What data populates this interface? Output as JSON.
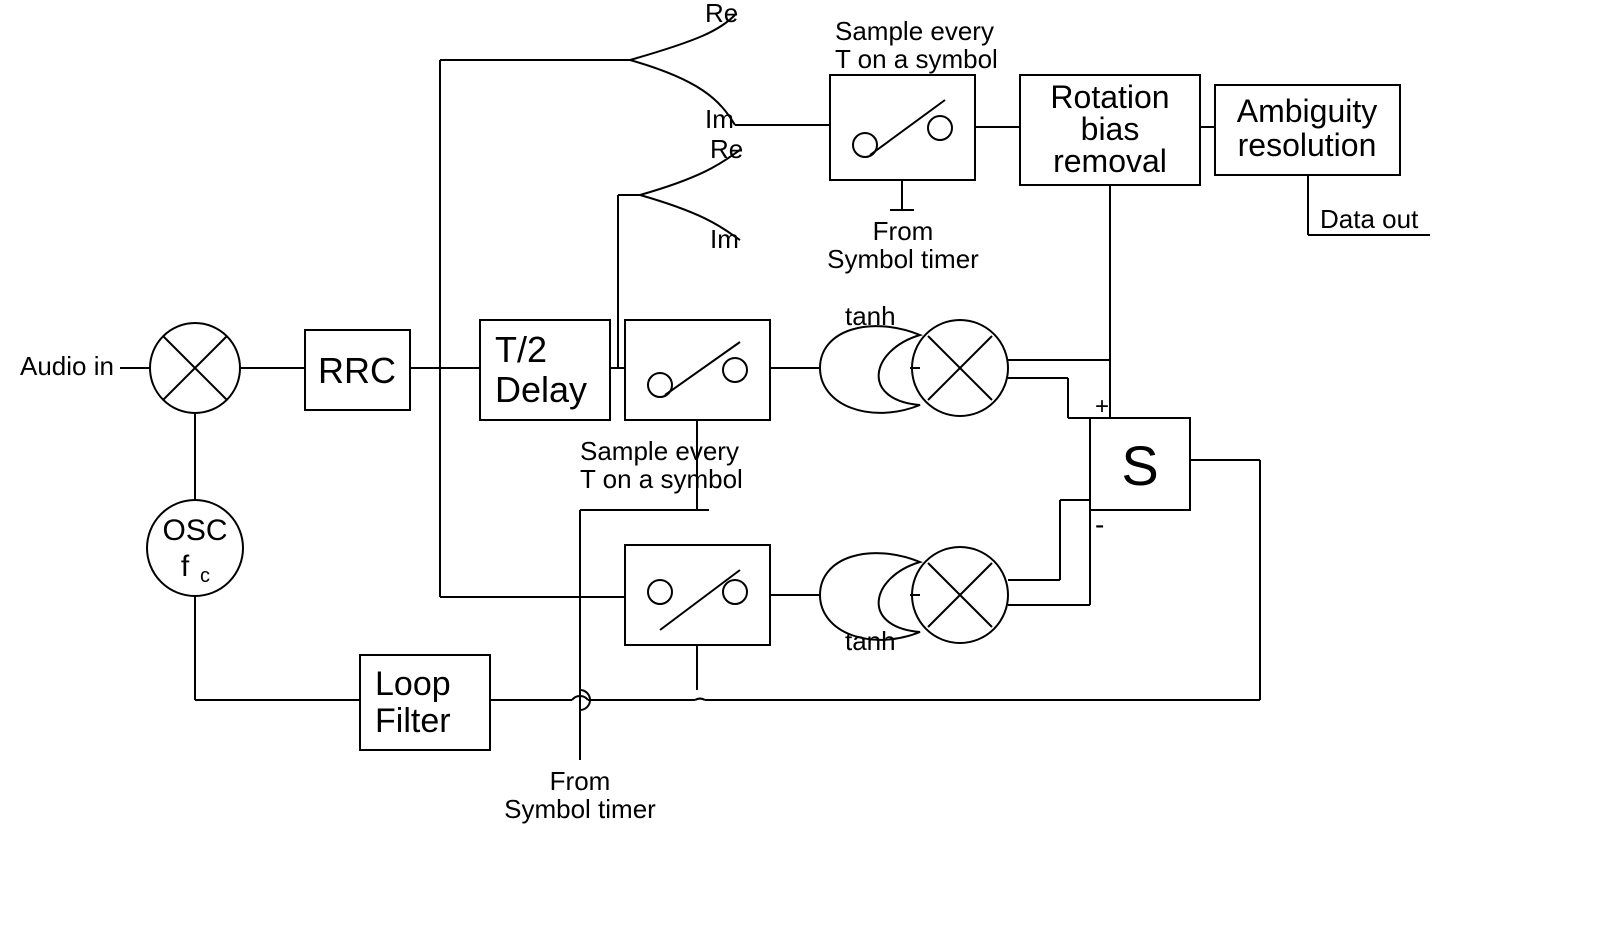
{
  "labels": {
    "audio_in": "Audio in",
    "osc": "OSC",
    "osc_fc": "f",
    "osc_fc_sub": "c",
    "rrc": "RRC",
    "delay_l1": "T/2",
    "delay_l2": "Delay",
    "loop_l1": "Loop",
    "loop_l2": "Filter",
    "re1": "Re",
    "im1": "Im",
    "re2": "Re",
    "im2": "Im",
    "samp_top_l1": "Sample every",
    "samp_top_l2": "T on a symbol",
    "samp_mid_l1": "Sample every",
    "samp_mid_l2": "T on a symbol",
    "from_st1_l1": "From",
    "from_st1_l2": "Symbol timer",
    "from_st2_l1": "From",
    "from_st2_l2": "Symbol timer",
    "tanh_top": "tanh",
    "tanh_bot": "tanh",
    "rot_l1": "Rotation",
    "rot_l2": "bias",
    "rot_l3": "removal",
    "amb_l1": "Ambiguity",
    "amb_l2": "resolution",
    "data_out": "Data out",
    "sum": "S",
    "plus": "+",
    "minus": "-"
  }
}
